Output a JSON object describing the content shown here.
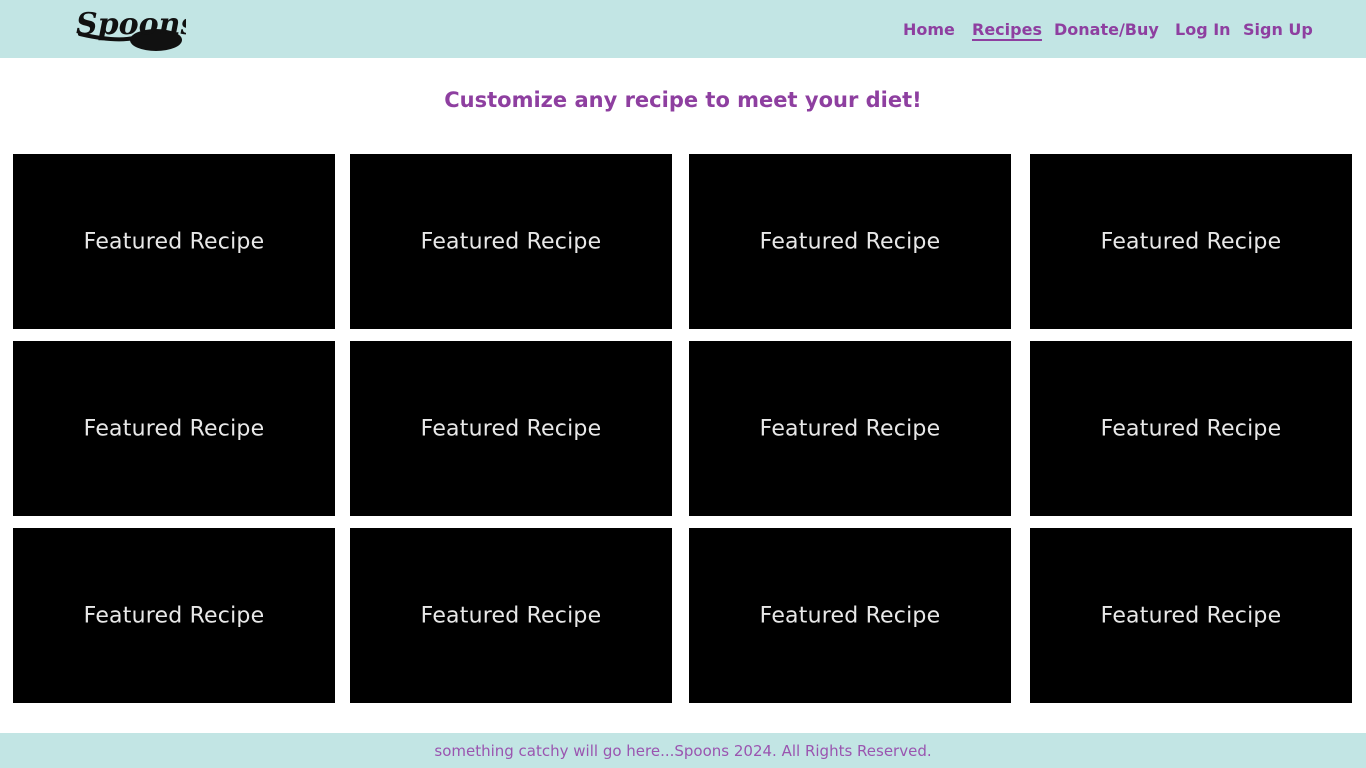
{
  "header": {
    "logo_text": "Spoons",
    "nav": [
      {
        "label": "Home",
        "active": false
      },
      {
        "label": "Recipes",
        "active": true
      },
      {
        "label": "Donate/Buy",
        "active": false
      },
      {
        "label": "Log In",
        "active": false
      },
      {
        "label": "Sign Up",
        "active": false
      }
    ]
  },
  "main": {
    "tagline": "Customize any recipe to meet your diet!",
    "cards": [
      {
        "label": "Featured Recipe"
      },
      {
        "label": "Featured Recipe"
      },
      {
        "label": "Featured Recipe"
      },
      {
        "label": "Featured Recipe"
      },
      {
        "label": "Featured Recipe"
      },
      {
        "label": "Featured Recipe"
      },
      {
        "label": "Featured Recipe"
      },
      {
        "label": "Featured Recipe"
      },
      {
        "label": "Featured Recipe"
      },
      {
        "label": "Featured Recipe"
      },
      {
        "label": "Featured Recipe"
      },
      {
        "label": "Featured Recipe"
      }
    ]
  },
  "footer": {
    "text": "something catchy will go here...Spoons 2024. All Rights Reserved."
  },
  "colors": {
    "header_bg": "#c2e5e4",
    "accent_purple": "#8e3fa0",
    "card_bg": "#000000"
  }
}
